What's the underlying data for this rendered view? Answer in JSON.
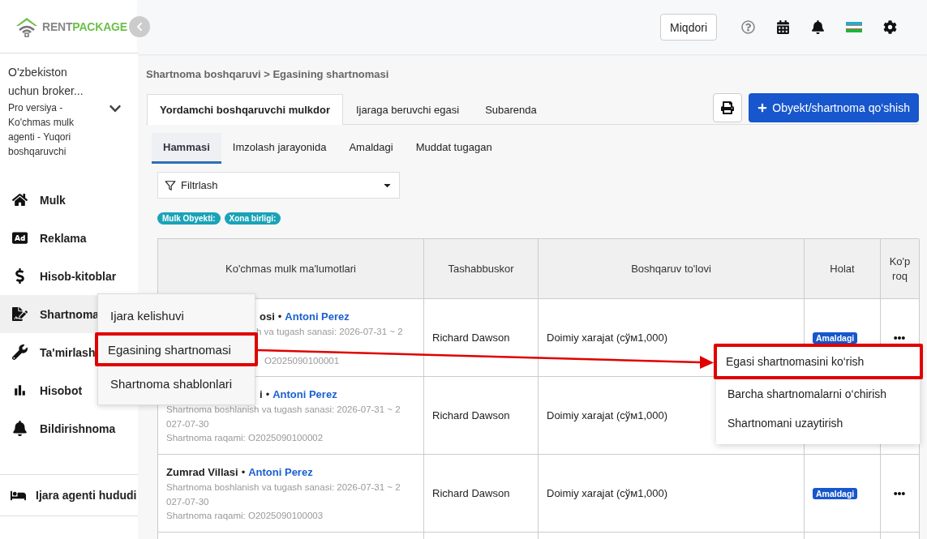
{
  "logo": {
    "part_a": "RENT",
    "part_b": "PACKAGE"
  },
  "header": {
    "button": "Miqdori"
  },
  "org": {
    "name": "O'zbekiston uchun broker...",
    "plan": "Pro versiya - Ko'chmas mulk agenti - Yuqori boshqaruvchi"
  },
  "nav": [
    {
      "label": "Mulk",
      "selected": false
    },
    {
      "label": "Reklama",
      "selected": false
    },
    {
      "label": "Hisob-kitoblar",
      "selected": false
    },
    {
      "label": "Shartnoma",
      "selected": true
    },
    {
      "label": "Ta'mirlash",
      "selected": false
    },
    {
      "label": "Hisobot",
      "selected": false
    },
    {
      "label": "Bildirishnoma",
      "selected": false
    }
  ],
  "nav_bottom": {
    "label": "Ijara agenti hududi"
  },
  "nav_submenu": [
    {
      "label": "Ijara kelishuvi",
      "highlighted": false
    },
    {
      "label": "Egasining shartnomasi",
      "highlighted": true
    },
    {
      "label": "Shartnoma shablonlari",
      "highlighted": false
    }
  ],
  "breadcrumb": "Shartnoma boshqaruvi > Egasining shartnomasi",
  "tabs": [
    {
      "label": "Yordamchi boshqaruvchi mulkdor",
      "selected": true
    },
    {
      "label": "Ijaraga beruvchi egasi",
      "selected": false
    },
    {
      "label": "Subarenda",
      "selected": false
    }
  ],
  "add_button": "Obyekt/shartnoma qo‘shish",
  "status_tabs": [
    {
      "label": "Hammasi",
      "selected": true
    },
    {
      "label": "Imzolash jarayonida",
      "selected": false
    },
    {
      "label": "Amaldagi",
      "selected": false
    },
    {
      "label": "Muddat tugagan",
      "selected": false
    }
  ],
  "filter": {
    "value": "Filtrlash"
  },
  "tags": [
    "Mulk Obyekti:",
    "Xona birligi:"
  ],
  "table": {
    "columns": [
      "Ko'chmas mulk ma'lumotlari",
      "Tashabbuskor",
      "Boshqaruv to'lovi",
      "Holat",
      "Ko'proq"
    ],
    "rows": [
      {
        "head": {
          "kind": "cut",
          "title": "osi",
          "sep": "•",
          "agent": "Antoni Perez"
        },
        "lines": [
          {
            "kind": "cut",
            "text": "h va tugash sanasi: 2026-07-31 ~ 2"
          },
          {
            "kind": "cut-low",
            "text": "O2025090100001"
          }
        ],
        "initiator": "Richard Dawson",
        "fee": "Doimiy xarajat (сўм1,000)",
        "status": "Amaldagi",
        "more_button": true
      },
      {
        "head": {
          "kind": "cut",
          "title": "i",
          "sep": "•",
          "agent": "Antoni Perez"
        },
        "lines": [
          {
            "kind": "full",
            "text": "Shartnoma boshlanish va tugash sanasi: 2026-07-31 ~ 2"
          },
          {
            "kind": "full",
            "text": "027-07-30"
          },
          {
            "kind": "full",
            "text": "Shartnoma raqami: O2025090100002"
          }
        ],
        "initiator": "Richard Dawson",
        "fee": "Doimiy xarajat (сўм1,000)"
      },
      {
        "head": {
          "kind": "full",
          "title": "Zumrad Villasi",
          "sep": "•",
          "agent": "Antoni Perez"
        },
        "lines": [
          {
            "kind": "full",
            "text": "Shartnoma boshlanish va tugash sanasi: 2026-07-31 ~ 2"
          },
          {
            "kind": "full",
            "text": "027-07-30"
          },
          {
            "kind": "full",
            "text": "Shartnoma raqami: O2025090100003"
          }
        ],
        "initiator": "Richard Dawson",
        "fee": "Doimiy xarajat (сўм1,000)",
        "status": "Amaldagi",
        "more_button": true
      }
    ]
  },
  "row_menu": [
    {
      "label": "Egasi shartnomasini ko‘rish",
      "highlighted": true
    },
    {
      "label": "Barcha shartnomalarni o‘chirish",
      "highlighted": false
    },
    {
      "label": "Shartnomani uzaytirish",
      "highlighted": false
    }
  ]
}
